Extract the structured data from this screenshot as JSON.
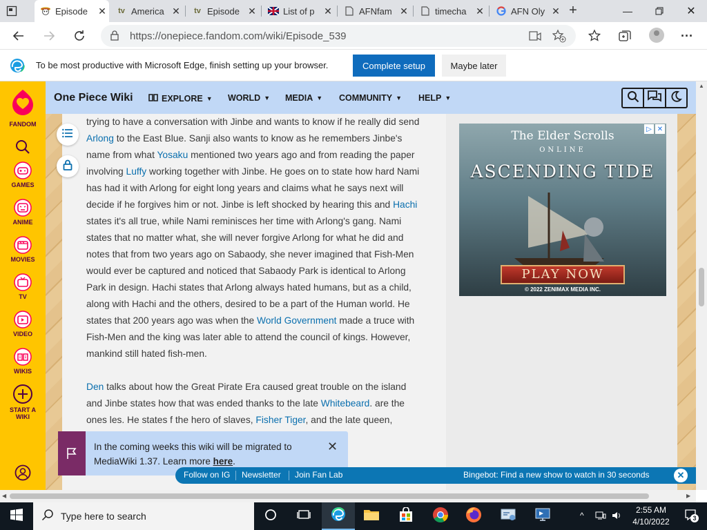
{
  "browser": {
    "tabs": [
      {
        "title": "Episode",
        "favicon": "one-piece-skull",
        "active": true
      },
      {
        "title": "America",
        "favicon": "tv"
      },
      {
        "title": "Episode",
        "favicon": "tv"
      },
      {
        "title": "List of p",
        "favicon": "flag"
      },
      {
        "title": "AFNfam",
        "favicon": "page"
      },
      {
        "title": "timecha",
        "favicon": "page"
      },
      {
        "title": "AFN Oly",
        "favicon": "google"
      }
    ],
    "url": "https://onepiece.fandom.com/wiki/Episode_539"
  },
  "setup_bar": {
    "message": "To be most productive with Microsoft Edge, finish setting up your browser.",
    "complete_label": "Complete setup",
    "later_label": "Maybe later"
  },
  "fandom_rail": {
    "logo_label": "FANDOM",
    "items": [
      {
        "label": "GAMES",
        "icon": "gamepad-icon"
      },
      {
        "label": "ANIME",
        "icon": "anime-icon"
      },
      {
        "label": "MOVIES",
        "icon": "movies-icon"
      },
      {
        "label": "TV",
        "icon": "tv-icon"
      },
      {
        "label": "VIDEO",
        "icon": "video-icon"
      },
      {
        "label": "WIKIS",
        "icon": "wikis-icon"
      },
      {
        "label": "START A WIKI",
        "icon": "plus-circle-icon"
      }
    ]
  },
  "wiki_header": {
    "title": "One Piece Wiki",
    "nav": [
      {
        "label": "EXPLORE"
      },
      {
        "label": "WORLD"
      },
      {
        "label": "MEDIA"
      },
      {
        "label": "COMMUNITY"
      },
      {
        "label": "HELP"
      }
    ]
  },
  "article": {
    "p1": [
      {
        "t": "trying to have a conversation with Jinbe and wants to know if he really did send "
      },
      {
        "t": "Arlong",
        "link": true
      },
      {
        "t": " to the East Blue. Sanji also wants to know as he remembers Jinbe's name from what "
      },
      {
        "t": "Yosaku",
        "link": true
      },
      {
        "t": " mentioned two years ago and from reading the paper involving "
      },
      {
        "t": "Luffy",
        "link": true
      },
      {
        "t": " working together with Jinbe. He goes on to state how hard Nami has had it with Arlong for eight long years and claims what he says next will decide if he forgives him or not. Jinbe is left shocked by hearing this and "
      },
      {
        "t": "Hachi",
        "link": true
      },
      {
        "t": " states it's all true, while Nami reminisces her time with Arlong's gang. Nami states that no matter what, she will never forgive Arlong for what he did and notes that from two years ago on Sabaody, she never imagined that Fish-Men would ever be captured and noticed that Sabaody Park is identical to Arlong Park in design. Hachi states that Arlong always hated humans, but as a child, along with Hachi and the others, desired to be a part of the Human world. He states that 200 years ago was when the "
      },
      {
        "t": "World Government",
        "link": true
      },
      {
        "t": " made a truce with Fish-Men and the king was later able to attend the council of kings. However, mankind still hated fish-men."
      }
    ],
    "p2": [
      {
        "t": "Den",
        "link": true
      },
      {
        "t": " talks about how the Great Pirate Era caused great trouble on the island and Jinbe states how that was ended thanks to the late "
      },
      {
        "t": "Whitebeard",
        "link": true
      },
      {
        "t": ". "
      },
      {
        "t": "                                                                  are the ones"
      },
      {
        "t": "                                                                           les. He states"
      },
      {
        "t": "                                                                                    f                  "
      },
      {
        "t": "the hero of slaves, "
      },
      {
        "t": "Fisher Tiger",
        "link": true
      },
      {
        "t": ", and the late queen, Otohime. While Luffy"
      }
    ]
  },
  "ad": {
    "line1": "The Elder Scrolls",
    "line2": "ONLINE",
    "line3": "ASCENDING TIDE",
    "cta": "PLAY NOW",
    "copyright": "© 2022 ZENIMAX MEDIA INC."
  },
  "notice": {
    "text_before": "In the coming weeks this wiki will be migrated to MediaWiki 1.37. Learn more ",
    "link": "here",
    "text_after": "."
  },
  "bottom_bar": {
    "links": [
      "Follow on IG",
      "Newsletter",
      "Join Fan Lab"
    ],
    "promo": "Bingebot: Find a new show to watch in 30 seconds"
  },
  "taskbar": {
    "search_placeholder": "Type here to search",
    "time": "2:55 AM",
    "date": "4/10/2022",
    "notifications": "3"
  }
}
